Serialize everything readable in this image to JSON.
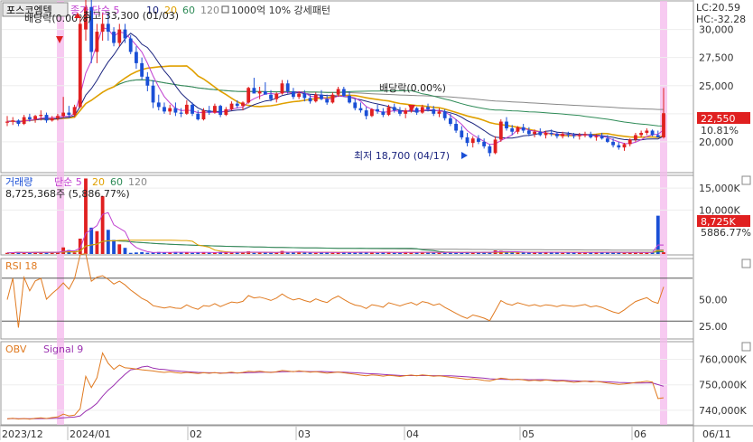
{
  "chart_data": {
    "type": "candlestick",
    "stock_name": "포스코엠텍",
    "x_labels": [
      "2023/12",
      "2024/01",
      "02",
      "03",
      "04",
      "05",
      "06",
      "06/11"
    ],
    "colors": {
      "up": "#e02020",
      "down": "#1a4fd6",
      "ma5": "#c03fd0",
      "ma10": "#1a237e",
      "ma20": "#e0a000",
      "ma60": "#2e8b57",
      "ma120": "#888888",
      "rsi": "#e07a20",
      "obv": "#e07a20",
      "obv_signal": "#9b30b0",
      "highlight": "#f4b8ec"
    },
    "price_panel": {
      "legend": [
        {
          "label": "종가 단순 5",
          "color": "#c03fd0"
        },
        {
          "label": "10",
          "color": "#1a237e"
        },
        {
          "label": "20",
          "color": "#e0a000"
        },
        {
          "label": "60",
          "color": "#2e8b57"
        },
        {
          "label": "120",
          "color": "#888888"
        },
        {
          "label": "1000억 10% 강세패턴",
          "color": "#333333"
        }
      ],
      "y_ticks": [
        "30,000",
        "27,500",
        "25,000",
        "22,550",
        "20,000"
      ],
      "ylim": [
        17500,
        32300
      ],
      "lc": "LC:20.59",
      "hc": "HC:-32.28",
      "last_price": "22,550",
      "last_change": "10.81%",
      "annotations": {
        "high": "최고 33,300 (01/03)",
        "low": "최저 18,700 (04/17)",
        "dividend1": "배당락(0.00%)",
        "dividend2": "배당락(0.00%)"
      },
      "candles": [
        [
          21700,
          22300,
          21400,
          21800
        ],
        [
          21800,
          22200,
          21500,
          21900
        ],
        [
          21900,
          22000,
          21400,
          21600
        ],
        [
          21600,
          22400,
          21500,
          22200
        ],
        [
          22200,
          22500,
          21800,
          22000
        ],
        [
          22000,
          22400,
          21700,
          22300
        ],
        [
          22300,
          22800,
          21900,
          22400
        ],
        [
          22400,
          22600,
          21700,
          21900
        ],
        [
          21900,
          22300,
          21800,
          22100
        ],
        [
          22100,
          22500,
          21900,
          22300
        ],
        [
          22300,
          24000,
          22100,
          22600
        ],
        [
          22600,
          23200,
          22100,
          22400
        ],
        [
          22400,
          23300,
          22200,
          23100
        ],
        [
          23100,
          31000,
          23000,
          30500
        ],
        [
          30000,
          33300,
          29000,
          32000
        ],
        [
          32000,
          33000,
          27000,
          28000
        ],
        [
          28000,
          30500,
          27000,
          29800
        ],
        [
          29800,
          31500,
          29000,
          30500
        ],
        [
          30500,
          31500,
          29000,
          29800
        ],
        [
          29800,
          30200,
          28500,
          28800
        ],
        [
          28800,
          30500,
          28500,
          30000
        ],
        [
          30000,
          30500,
          28800,
          29200
        ],
        [
          29200,
          29500,
          27800,
          28000
        ],
        [
          28000,
          28500,
          26500,
          27000
        ],
        [
          27000,
          27500,
          25500,
          25800
        ],
        [
          25800,
          26200,
          24500,
          25000
        ],
        [
          25000,
          25500,
          23000,
          23500
        ],
        [
          23500,
          24200,
          22800,
          23100
        ],
        [
          23100,
          23500,
          22500,
          22700
        ],
        [
          22700,
          23300,
          22400,
          23000
        ],
        [
          23000,
          23500,
          22300,
          22600
        ],
        [
          22600,
          23000,
          22200,
          22500
        ],
        [
          22500,
          23700,
          22400,
          23300
        ],
        [
          23300,
          23500,
          22300,
          22500
        ],
        [
          22500,
          22800,
          21900,
          22000
        ],
        [
          22000,
          23000,
          21900,
          22800
        ],
        [
          22800,
          23200,
          22400,
          22600
        ],
        [
          22600,
          23400,
          22500,
          23200
        ],
        [
          23200,
          23300,
          22200,
          22400
        ],
        [
          22400,
          23100,
          22300,
          22900
        ],
        [
          22900,
          23600,
          22800,
          23400
        ],
        [
          23400,
          23700,
          23000,
          23200
        ],
        [
          23200,
          23600,
          22800,
          23500
        ],
        [
          23500,
          24900,
          23400,
          24800
        ],
        [
          24800,
          25700,
          24500,
          24300
        ],
        [
          24300,
          24900,
          23800,
          24500
        ],
        [
          24500,
          25300,
          24300,
          24200
        ],
        [
          24200,
          24600,
          23600,
          23800
        ],
        [
          23800,
          24400,
          23500,
          24300
        ],
        [
          24300,
          25500,
          24200,
          25200
        ],
        [
          25200,
          25500,
          24300,
          24500
        ],
        [
          24500,
          24800,
          23800,
          24000
        ],
        [
          24000,
          24500,
          23800,
          24300
        ],
        [
          24300,
          24600,
          23600,
          23900
        ],
        [
          23900,
          24200,
          23400,
          23600
        ],
        [
          23600,
          24400,
          23500,
          24200
        ],
        [
          24200,
          24600,
          23700,
          23800
        ],
        [
          23800,
          24200,
          23300,
          23500
        ],
        [
          23500,
          24400,
          23400,
          24200
        ],
        [
          24200,
          24900,
          24000,
          24700
        ],
        [
          24700,
          24900,
          24000,
          24100
        ],
        [
          24100,
          24500,
          23400,
          23500
        ],
        [
          23500,
          23800,
          22800,
          23000
        ],
        [
          23000,
          23500,
          22600,
          22800
        ],
        [
          22800,
          23100,
          22000,
          22300
        ],
        [
          22300,
          23000,
          22200,
          22900
        ],
        [
          22900,
          23300,
          22500,
          22700
        ],
        [
          22700,
          23000,
          22200,
          22400
        ],
        [
          22400,
          23300,
          22300,
          23100
        ],
        [
          23100,
          23400,
          22600,
          22800
        ],
        [
          22800,
          23100,
          22300,
          22500
        ],
        [
          22500,
          23000,
          22100,
          22800
        ],
        [
          22800,
          23200,
          22600,
          23000
        ],
        [
          23000,
          23100,
          22400,
          22600
        ],
        [
          22600,
          23300,
          22500,
          23100
        ],
        [
          23100,
          23400,
          22700,
          22900
        ],
        [
          22900,
          23200,
          22300,
          22500
        ],
        [
          22500,
          23000,
          22200,
          22700
        ],
        [
          22700,
          22900,
          21900,
          22100
        ],
        [
          22100,
          22500,
          21400,
          21600
        ],
        [
          21600,
          22000,
          20800,
          21000
        ],
        [
          21000,
          21400,
          20200,
          20400
        ],
        [
          20400,
          20800,
          19600,
          19900
        ],
        [
          19900,
          20500,
          19500,
          20300
        ],
        [
          20300,
          20600,
          19800,
          20000
        ],
        [
          20000,
          20300,
          19400,
          19600
        ],
        [
          19600,
          19800,
          18700,
          19000
        ],
        [
          19000,
          20500,
          18900,
          20200
        ],
        [
          20200,
          22000,
          20000,
          21800
        ],
        [
          21800,
          22200,
          21000,
          21200
        ],
        [
          21200,
          21500,
          20600,
          20900
        ],
        [
          20900,
          21400,
          20700,
          21300
        ],
        [
          21300,
          21600,
          20800,
          21000
        ],
        [
          21000,
          21300,
          20500,
          20700
        ],
        [
          20700,
          21100,
          20400,
          20900
        ],
        [
          20900,
          21200,
          20500,
          20600
        ],
        [
          20600,
          21000,
          20300,
          20800
        ],
        [
          20800,
          21100,
          20500,
          20700
        ],
        [
          20700,
          20900,
          20300,
          20500
        ],
        [
          20500,
          20900,
          20300,
          20700
        ],
        [
          20700,
          20900,
          20400,
          20600
        ],
        [
          20600,
          20800,
          20300,
          20500
        ],
        [
          20500,
          20800,
          20200,
          20600
        ],
        [
          20600,
          20900,
          20400,
          20700
        ],
        [
          20700,
          20900,
          20300,
          20400
        ],
        [
          20400,
          20700,
          20100,
          20500
        ],
        [
          20500,
          20800,
          20200,
          20300
        ],
        [
          20300,
          20600,
          19900,
          20000
        ],
        [
          20000,
          20300,
          19500,
          19700
        ],
        [
          19700,
          20000,
          19300,
          19500
        ],
        [
          19500,
          19900,
          19200,
          19800
        ],
        [
          19800,
          20300,
          19600,
          20200
        ],
        [
          20200,
          20800,
          20000,
          20600
        ],
        [
          20600,
          21000,
          20400,
          20800
        ],
        [
          20800,
          21200,
          20600,
          21000
        ],
        [
          21000,
          21100,
          20500,
          20600
        ],
        [
          20600,
          21000,
          20500,
          20400
        ],
        [
          20400,
          24800,
          20300,
          22550
        ]
      ]
    },
    "volume_panel": {
      "legend": [
        {
          "label": "거래량",
          "color": "#1a4fd6"
        },
        {
          "label": "단순 5",
          "color": "#c03fd0"
        },
        {
          "label": "20",
          "color": "#e0a000"
        },
        {
          "label": "60",
          "color": "#2e8b57"
        },
        {
          "label": "120",
          "color": "#888888"
        }
      ],
      "summary": "8,725,368주 (5,886.77%)",
      "y_ticks": [
        "15,000K",
        "10,000K"
      ],
      "last_volume": "8,725K",
      "last_volume_pct": "5886.77%",
      "ylim": [
        0,
        17500
      ]
    },
    "rsi_panel": {
      "legend": [
        {
          "label": "RSI 18",
          "color": "#e07a20"
        }
      ],
      "y_ticks": [
        "50.00",
        "25.00"
      ],
      "ylim": [
        15,
        85
      ],
      "levels": [
        70,
        30
      ]
    },
    "obv_panel": {
      "legend": [
        {
          "label": "OBV",
          "color": "#e07a20"
        },
        {
          "label": "Signal 9",
          "color": "#9b30b0"
        }
      ],
      "y_ticks": [
        "760,000K",
        "750,000K",
        "740,000K"
      ],
      "ylim": [
        735000,
        765500
      ]
    }
  }
}
